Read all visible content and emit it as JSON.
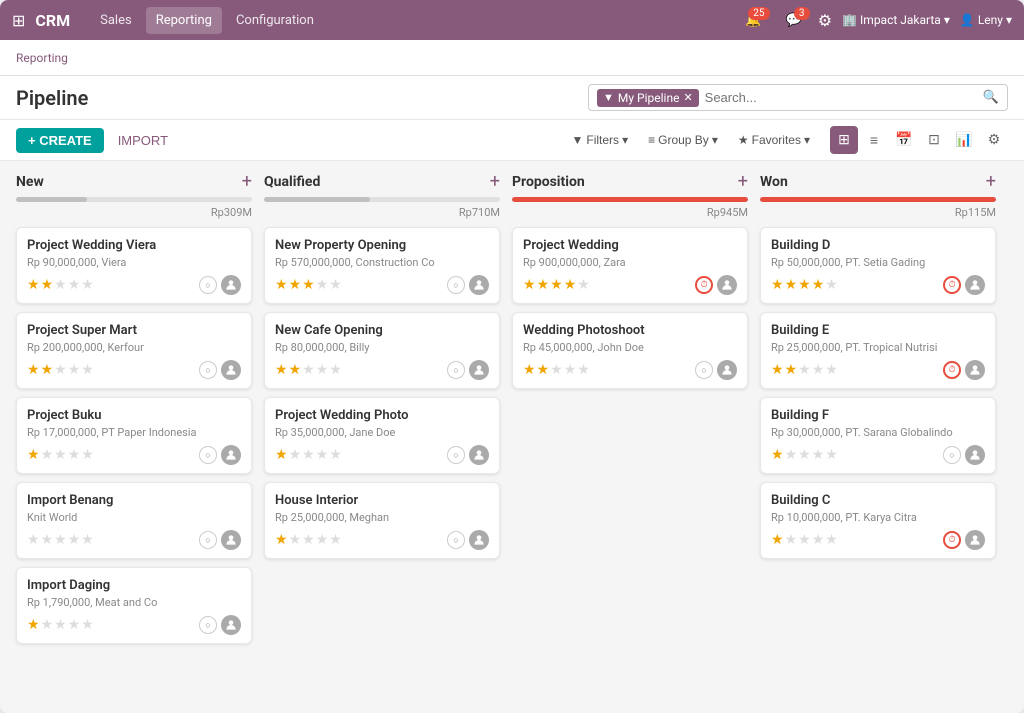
{
  "app": {
    "brand": "CRM",
    "nav_items": [
      "Sales",
      "Reporting",
      "Configuration"
    ],
    "active_nav": "Sales",
    "badges": {
      "notification_count": "25",
      "message_count": "3"
    },
    "org": "Impact Jakarta",
    "user": "Leny"
  },
  "breadcrumb": {
    "items": [
      "Reporting"
    ]
  },
  "header": {
    "title": "Pipeline",
    "filter_tag": "My Pipeline",
    "search_placeholder": "Search..."
  },
  "toolbar": {
    "create_label": "+ CREATE",
    "import_label": "IMPORT",
    "filters_label": "Filters",
    "group_by_label": "Group By",
    "favorites_label": "Favorites"
  },
  "columns": [
    {
      "id": "new",
      "title": "New",
      "amount": "Rp309M",
      "progress": 30,
      "is_red": false,
      "cards": [
        {
          "title": "Project Wedding Viera",
          "subtitle": "Rp 90,000,000, Viera",
          "stars": 2,
          "has_clock": false
        },
        {
          "title": "Project Super Mart",
          "subtitle": "Rp 200,000,000, Kerfour",
          "stars": 2,
          "has_clock": false
        },
        {
          "title": "Project Buku",
          "subtitle": "Rp 17,000,000, PT Paper Indonesia",
          "stars": 1,
          "has_clock": false
        },
        {
          "title": "Import Benang",
          "subtitle": "Knit World",
          "stars": 0,
          "has_clock": false
        },
        {
          "title": "Import Daging",
          "subtitle": "Rp 1,790,000, Meat and Co",
          "stars": 1,
          "has_clock": false
        }
      ]
    },
    {
      "id": "qualified",
      "title": "Qualified",
      "amount": "Rp710M",
      "progress": 45,
      "is_red": false,
      "cards": [
        {
          "title": "New Property Opening",
          "subtitle": "Rp 570,000,000, Construction Co",
          "stars": 3,
          "has_clock": false
        },
        {
          "title": "New Cafe Opening",
          "subtitle": "Rp 80,000,000, Billy",
          "stars": 2,
          "has_clock": false
        },
        {
          "title": "Project Wedding Photo",
          "subtitle": "Rp 35,000,000, Jane Doe",
          "stars": 1,
          "has_clock": false
        },
        {
          "title": "House Interior",
          "subtitle": "Rp 25,000,000, Meghan",
          "stars": 1,
          "has_clock": false
        }
      ]
    },
    {
      "id": "proposition",
      "title": "Proposition",
      "amount": "Rp945M",
      "progress": 100,
      "is_red": true,
      "cards": [
        {
          "title": "Project Wedding",
          "subtitle": "Rp 900,000,000, Zara",
          "stars": 4,
          "has_clock": true
        },
        {
          "title": "Wedding Photoshoot",
          "subtitle": "Rp 45,000,000, John Doe",
          "stars": 2,
          "has_clock": false
        }
      ]
    },
    {
      "id": "won",
      "title": "Won",
      "amount": "Rp115M",
      "progress": 100,
      "is_red": true,
      "cards": [
        {
          "title": "Building D",
          "subtitle": "Rp 50,000,000, PT. Setia Gading",
          "stars": 4,
          "has_clock": true
        },
        {
          "title": "Building E",
          "subtitle": "Rp 25,000,000, PT. Tropical Nutrisi",
          "stars": 2,
          "has_clock": true
        },
        {
          "title": "Building F",
          "subtitle": "Rp 30,000,000, PT. Sarana Globalindo",
          "stars": 1,
          "has_clock": false
        },
        {
          "title": "Building C",
          "subtitle": "Rp 10,000,000, PT. Karya Citra",
          "stars": 1,
          "has_clock": true
        }
      ]
    }
  ]
}
